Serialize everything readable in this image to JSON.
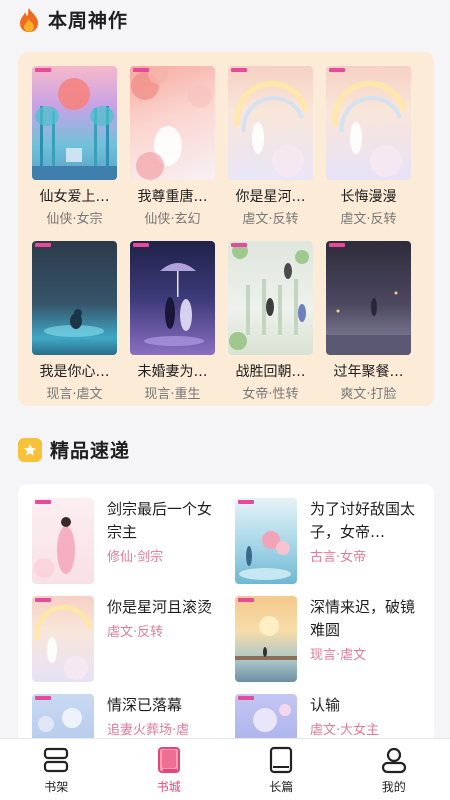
{
  "weekly": {
    "title": "本周神作",
    "books": [
      {
        "name": "仙女爱上…",
        "genre": "仙侠·女宗"
      },
      {
        "name": "我尊重唐…",
        "genre": "仙侠·玄幻"
      },
      {
        "name": "你是星河…",
        "genre": "虐文·反转"
      },
      {
        "name": "长悔漫漫",
        "genre": "虐文·反转"
      },
      {
        "name": "我是你心…",
        "genre": "现言·虐文"
      },
      {
        "name": "未婚妻为…",
        "genre": "现言·重生"
      },
      {
        "name": "战胜回朝…",
        "genre": "女帝·性转"
      },
      {
        "name": "过年聚餐…",
        "genre": "爽文·打脸"
      }
    ]
  },
  "quality": {
    "title": "精品速递",
    "items": [
      {
        "title": "剑宗最后一个女宗主",
        "genre": "修仙·剑宗"
      },
      {
        "title": "为了讨好敌国太子，女帝…",
        "genre": "古言·女帝"
      },
      {
        "title": "你是星河且滚烫",
        "genre": "虐文·反转"
      },
      {
        "title": "深情来迟，破镜难圆",
        "genre": "现言·虐文"
      },
      {
        "title": "情深已落幕",
        "genre": "追妻火葬场·虐"
      },
      {
        "title": "认输",
        "genre": "虐文·大女主"
      }
    ]
  },
  "tabs": [
    {
      "label": "书架",
      "icon": "bookshelf-icon",
      "active": false
    },
    {
      "label": "书城",
      "icon": "bookstore-icon",
      "active": true
    },
    {
      "label": "长篇",
      "icon": "long-novel-icon",
      "active": false
    },
    {
      "label": "我的",
      "icon": "profile-icon",
      "active": false
    }
  ],
  "colors": {
    "accent": "#e5457a",
    "panel": "#fbebd7"
  }
}
